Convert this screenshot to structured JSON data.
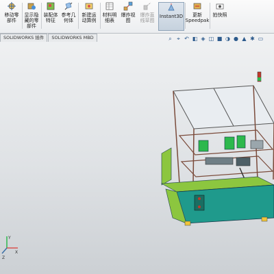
{
  "ribbon": {
    "buttons": [
      {
        "label1": "移动零",
        "label2": "部件",
        "label3": ""
      },
      {
        "label1": "显示隐",
        "label2": "藏的零",
        "label3": "部件"
      },
      {
        "label1": "装配体",
        "label2": "特征",
        "label3": ""
      },
      {
        "label1": "参考几",
        "label2": "何体",
        "label3": ""
      },
      {
        "label1": "新建运",
        "label2": "动算例",
        "label3": ""
      },
      {
        "label1": "材料明",
        "label2": "细表",
        "label3": ""
      },
      {
        "label1": "爆炸视",
        "label2": "图",
        "label3": ""
      },
      {
        "label1": "爆炸直",
        "label2": "线草图",
        "label3": ""
      },
      {
        "label1": "Instant3D",
        "label2": "",
        "label3": ""
      },
      {
        "label1": "更新",
        "label2": "Speedpak",
        "label3": ""
      },
      {
        "label1": "拍快照",
        "label2": "",
        "label3": ""
      }
    ]
  },
  "tabs": [
    "SOLIDWORKS 插件",
    "SOLIDWORKS MBD"
  ],
  "view_toolbar": {
    "icons": [
      "zoom-fit-icon",
      "zoom-area-icon",
      "previous-view-icon",
      "section-view-icon",
      "dynamic-annotation-icon",
      "view-orientation-icon",
      "display-style-icon",
      "hide-show-icon",
      "edit-appearance-icon",
      "scene-icon",
      "view-settings-icon",
      "monitor-icon"
    ]
  },
  "colors": {
    "machine_frame": "#7a4a3a",
    "panel_green": "#8cc63f",
    "base_teal": "#1f9a8c",
    "highlight_green": "#2db84d"
  },
  "triad": {
    "x_label": "X",
    "y_label": "Y",
    "z_label": "Z"
  }
}
